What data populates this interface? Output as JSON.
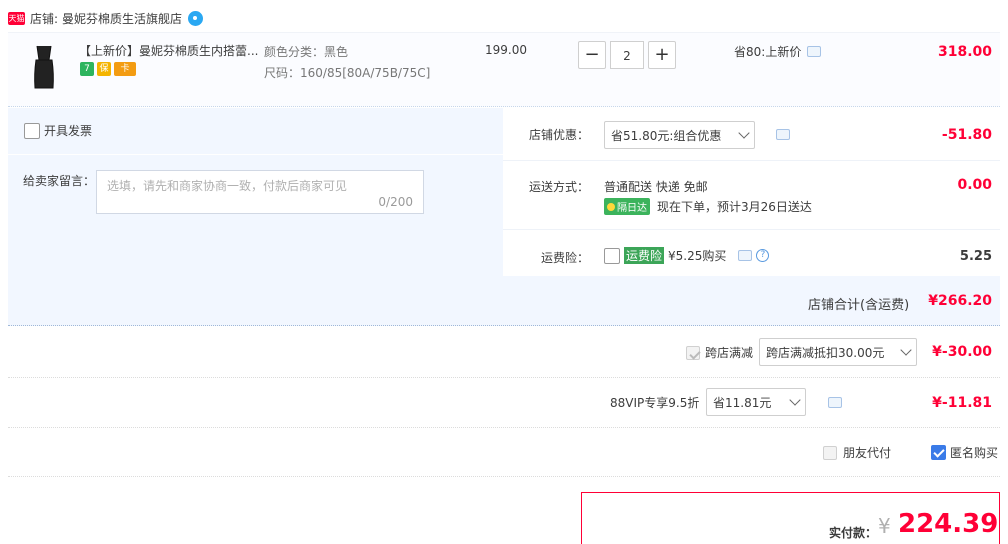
{
  "shop": {
    "badge": "天猫",
    "label": "店铺:",
    "name": "曼妮芬棉质生活旗舰店"
  },
  "item": {
    "title": "【上新价】曼妮芬棉质生内搭蕾...",
    "badges": [
      "7",
      "保",
      "卡"
    ],
    "sku_color": "颜色分类：黑色",
    "sku_size": "尺码：160/85[80A/75B/75C]",
    "price": "199.00",
    "quantity": "2",
    "minus": "−",
    "plus": "+",
    "promo": "省80:上新价",
    "total": "318.00"
  },
  "invoice": {
    "label": "开具发票"
  },
  "message": {
    "label": "给卖家留言：",
    "placeholder": "选填，请先和商家协商一致，付款后商家可见",
    "count": "0/200"
  },
  "shop_discount": {
    "label": "店铺优惠：",
    "selected": "省51.80元:组合优惠",
    "amount": "-51.80"
  },
  "shipping": {
    "label": "运送方式：",
    "method": "普通配送 快递 免邮",
    "badge": "隔日达",
    "note": "现在下单，预计3月26日送达",
    "amount": "0.00"
  },
  "insurance": {
    "label": "运费险：",
    "tag": "运费险",
    "price": "¥5.25购买",
    "amount": "5.25"
  },
  "subtotal": {
    "label": "店铺合计(含运费)",
    "amount": "¥266.20"
  },
  "cross_shop": {
    "label": "跨店满减",
    "selected": "跨店满减抵扣30.00元",
    "amount": "¥-30.00"
  },
  "vip": {
    "label": "88VIP专享9.5折",
    "selected": "省11.81元",
    "amount": "¥-11.81"
  },
  "options": {
    "friend_pay": "朋友代付",
    "anonymous": "匿名购买"
  },
  "payment": {
    "label": "实付款：",
    "currency": "¥",
    "amount": "224.39"
  },
  "colors": {
    "accent_red": "#ff0036",
    "light_blue_bg": "#f2f7ff",
    "checkbox_blue": "#3a7be8"
  }
}
